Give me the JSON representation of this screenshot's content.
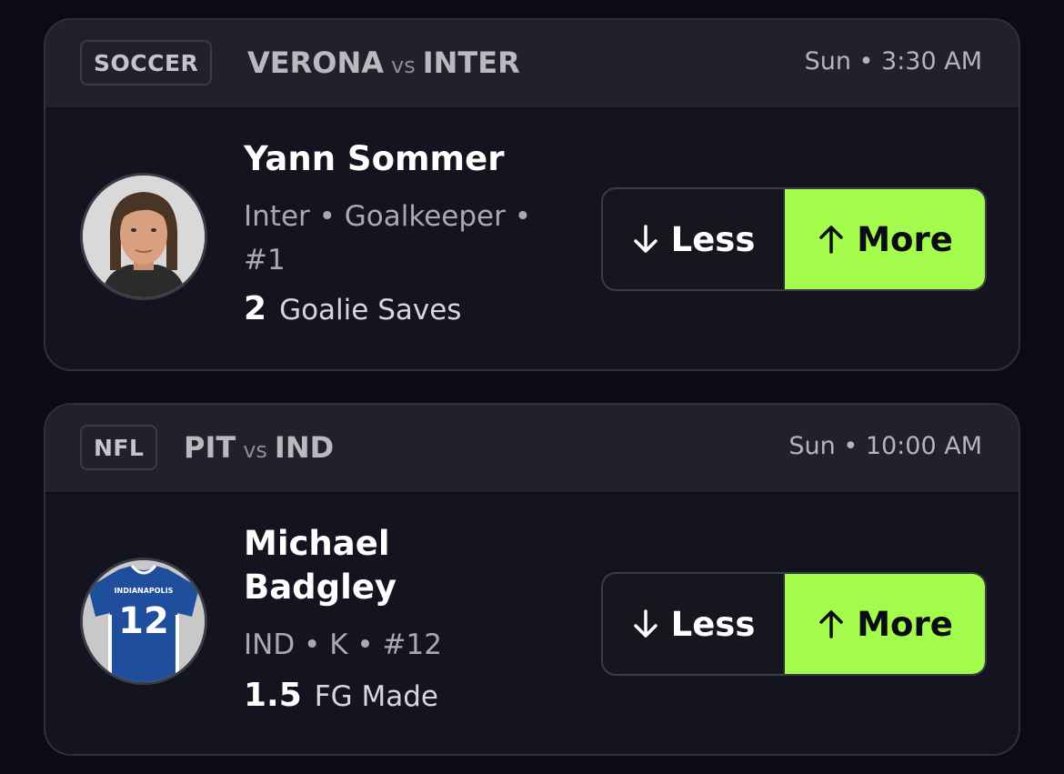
{
  "cards": [
    {
      "sport": "SOCCER",
      "team_a": "VERONA",
      "vs": "vs",
      "team_b": "INTER",
      "time": "Sun • 3:30 AM",
      "player": {
        "name": "Yann Sommer",
        "meta": "Inter • Goalkeeper • #1",
        "stat_value": "2",
        "stat_label": "Goalie Saves",
        "avatar": "player-headshot"
      },
      "less_label": "Less",
      "more_label": "More"
    },
    {
      "sport": "NFL",
      "team_a": "PIT",
      "vs": "vs",
      "team_b": "IND",
      "time": "Sun • 10:00 AM",
      "player": {
        "name": "Michael Badgley",
        "meta": "IND • K • #12",
        "stat_value": "1.5",
        "stat_label": "FG Made",
        "avatar": "jersey-icon",
        "jersey_text": "INDIANAPOLIS",
        "jersey_number": "12"
      },
      "less_label": "Less",
      "more_label": "More"
    }
  ],
  "colors": {
    "background": "#0b0b13",
    "card": "#141420",
    "header": "#21212b",
    "accent_more": "#a3fb4c",
    "jersey_blue": "#1f4e9c"
  }
}
